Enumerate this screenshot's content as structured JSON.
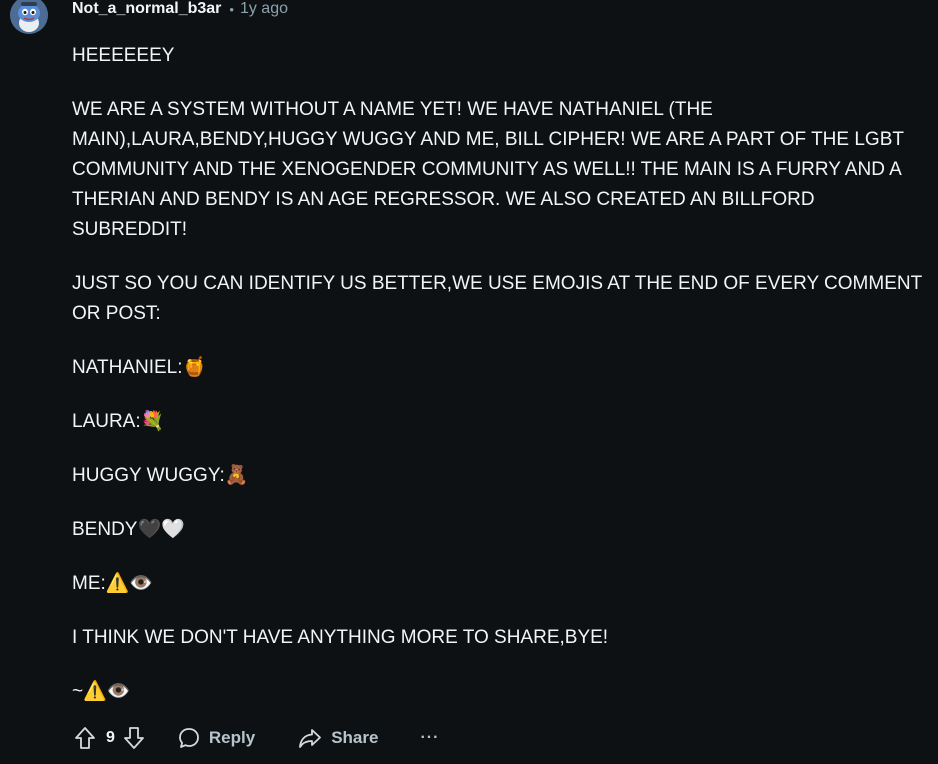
{
  "comment": {
    "author": "Not_a_normal_b3ar",
    "separator": "•",
    "time": "1y ago",
    "paragraphs": [
      "HEEEEEEY",
      "WE ARE A SYSTEM WITHOUT A NAME YET! WE HAVE NATHANIEL (THE MAIN),LAURA,BENDY,HUGGY WUGGY AND ME, BILL CIPHER! WE ARE A PART OF THE LGBT COMMUNITY AND THE XENOGENDER COMMUNITY AS WELL!! THE MAIN IS A FURRY AND A THERIAN AND BENDY IS AN AGE REGRESSOR. WE ALSO CREATED AN BILLFORD SUBREDDIT!",
      "JUST SO YOU CAN IDENTIFY US BETTER,WE USE EMOJIS AT THE END OF EVERY COMMENT OR POST:",
      "NATHANIEL:🍯",
      "LAURA:💐",
      "HUGGY WUGGY:🧸",
      "BENDY🖤🤍",
      "ME:⚠️👁️",
      "I THINK WE DON'T HAVE ANYTHING MORE TO SHARE,BYE!",
      "~⚠️👁️"
    ]
  },
  "actions": {
    "score": "9",
    "reply_label": "Reply",
    "share_label": "Share",
    "more_label": "···"
  },
  "icons": {
    "upvote": "upvote-arrow-icon",
    "downvote": "downvote-arrow-icon",
    "reply": "speech-bubble-icon",
    "share": "share-arrow-icon"
  },
  "colors": {
    "background": "#0e1113",
    "text": "#f2f4f5",
    "muted": "#8ba2ad",
    "action": "#b7c4cb"
  }
}
